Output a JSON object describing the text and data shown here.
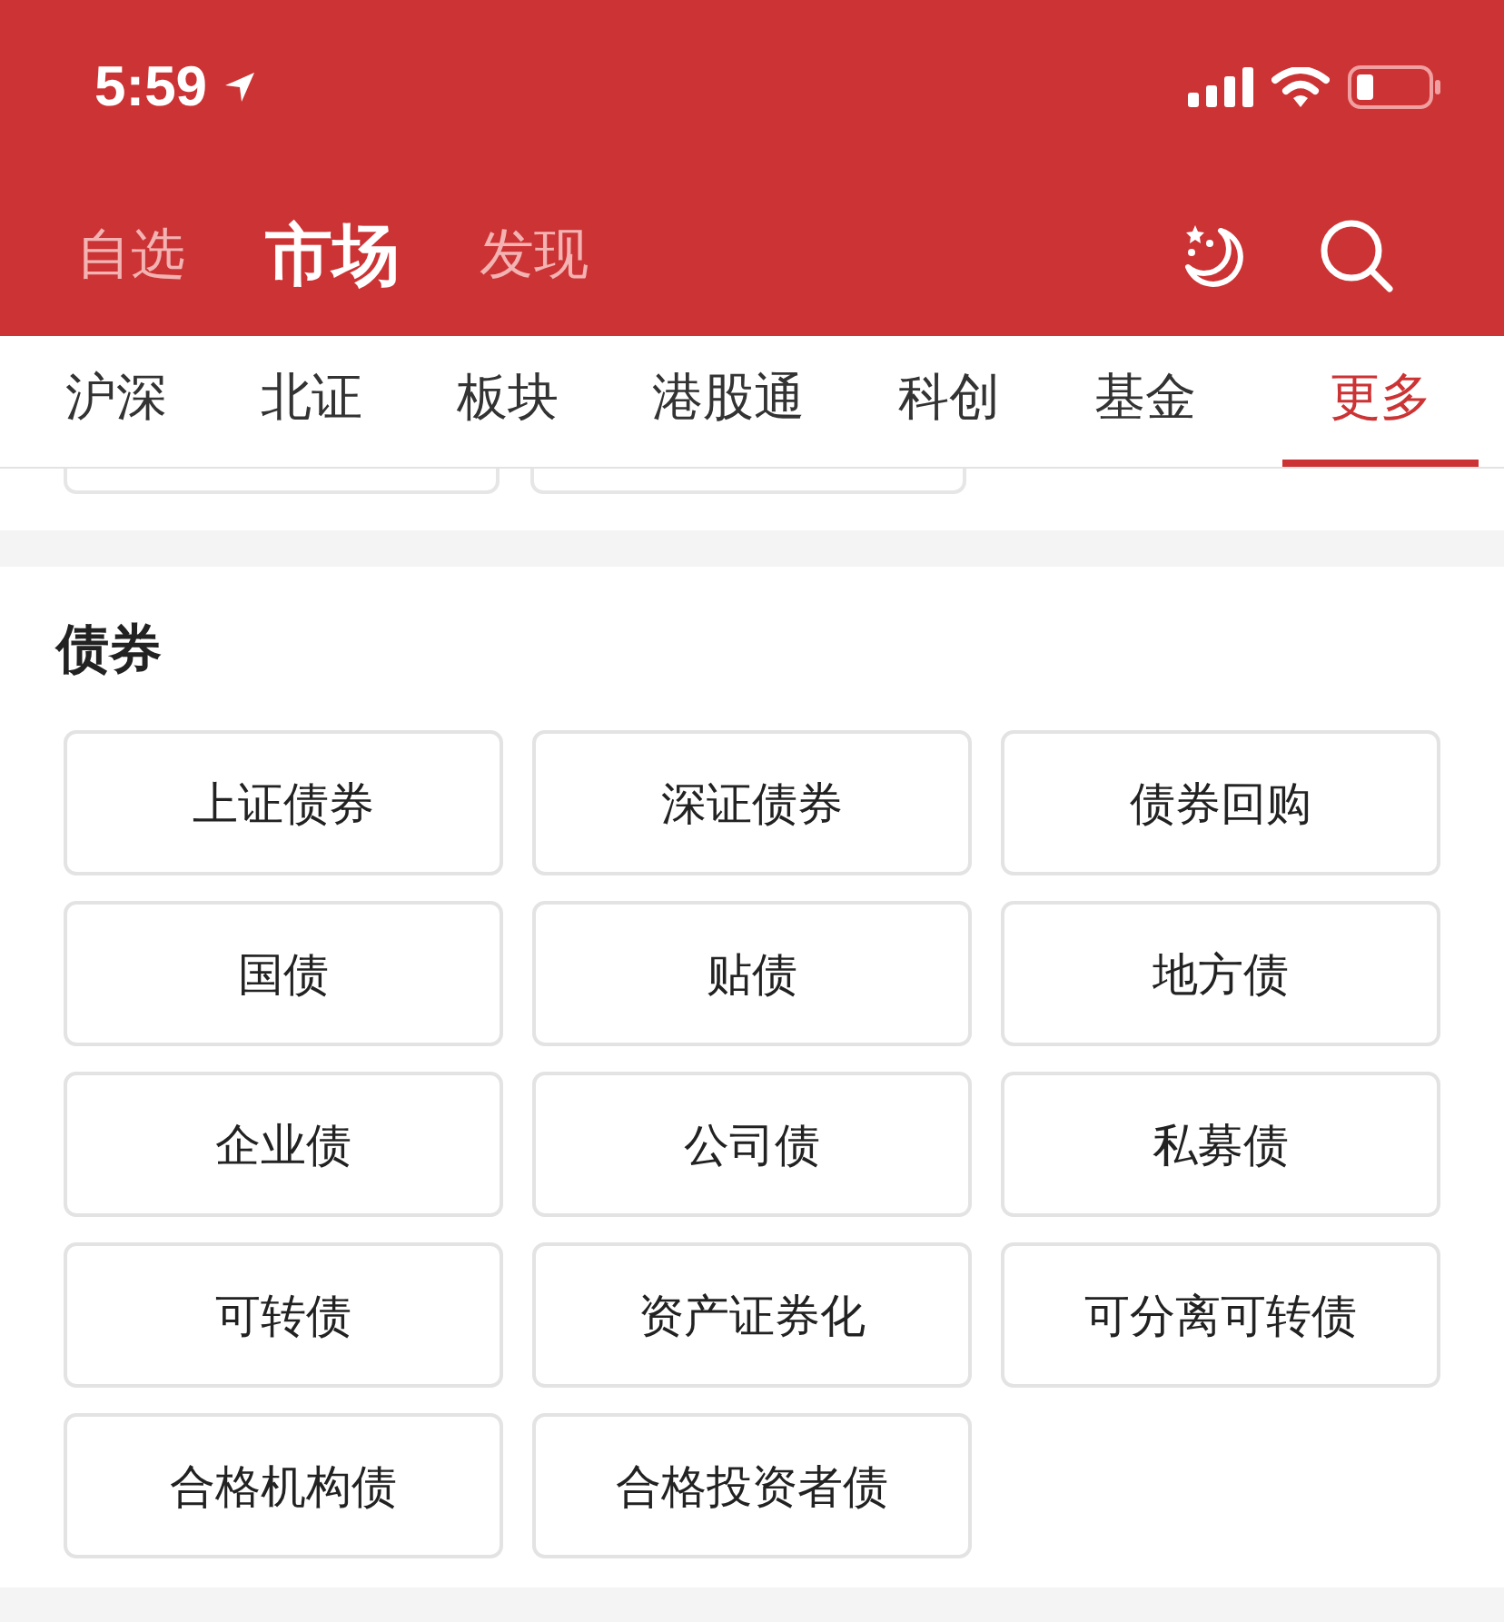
{
  "status_bar": {
    "time": "5:59"
  },
  "header": {
    "tabs": [
      {
        "label": "自选",
        "selected": false
      },
      {
        "label": "市场",
        "selected": true
      },
      {
        "label": "发现",
        "selected": false
      }
    ]
  },
  "category_tabs": [
    {
      "label": "沪深",
      "selected": false
    },
    {
      "label": "北证",
      "selected": false
    },
    {
      "label": "板块",
      "selected": false
    },
    {
      "label": "港股通",
      "selected": false
    },
    {
      "label": "科创",
      "selected": false
    },
    {
      "label": "基金",
      "selected": false
    },
    {
      "label": "更多",
      "selected": true
    }
  ],
  "section": {
    "title": "债券",
    "items": [
      "上证债券",
      "深证债券",
      "债券回购",
      "国债",
      "贴债",
      "地方债",
      "企业债",
      "公司债",
      "私募债",
      "可转债",
      "资产证券化",
      "可分离可转债",
      "合格机构债",
      "合格投资者债"
    ]
  }
}
